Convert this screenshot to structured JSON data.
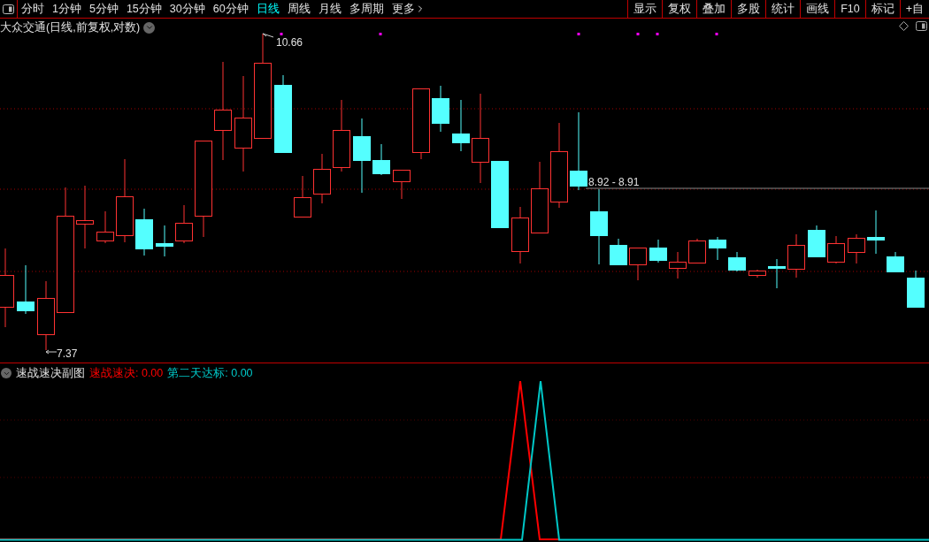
{
  "toolbar": {
    "tabs": [
      {
        "label": "分时",
        "selected": false
      },
      {
        "label": "1分钟",
        "selected": false
      },
      {
        "label": "5分钟",
        "selected": false
      },
      {
        "label": "15分钟",
        "selected": false
      },
      {
        "label": "30分钟",
        "selected": false
      },
      {
        "label": "60分钟",
        "selected": false
      },
      {
        "label": "日线",
        "selected": true
      },
      {
        "label": "周线",
        "selected": false
      },
      {
        "label": "月线",
        "selected": false
      },
      {
        "label": "多周期",
        "selected": false
      },
      {
        "label": "更多",
        "selected": false
      }
    ],
    "buttons": [
      "显示",
      "复权",
      "叠加",
      "多股",
      "统计",
      "画线",
      "F10",
      "标记",
      "+自"
    ]
  },
  "chart": {
    "title": "大众交通(日线,前复权,对数)",
    "high_label": "10.66",
    "low_label": "7.37",
    "price_line_label": "8.92 - 8.91"
  },
  "indicator": {
    "title": "速战速决副图",
    "series": [
      {
        "label": "速战速决: 0.00",
        "color": "#ff0000"
      },
      {
        "label": "第二天达标: 0.00",
        "color": "#00c8c8"
      }
    ]
  }
}
